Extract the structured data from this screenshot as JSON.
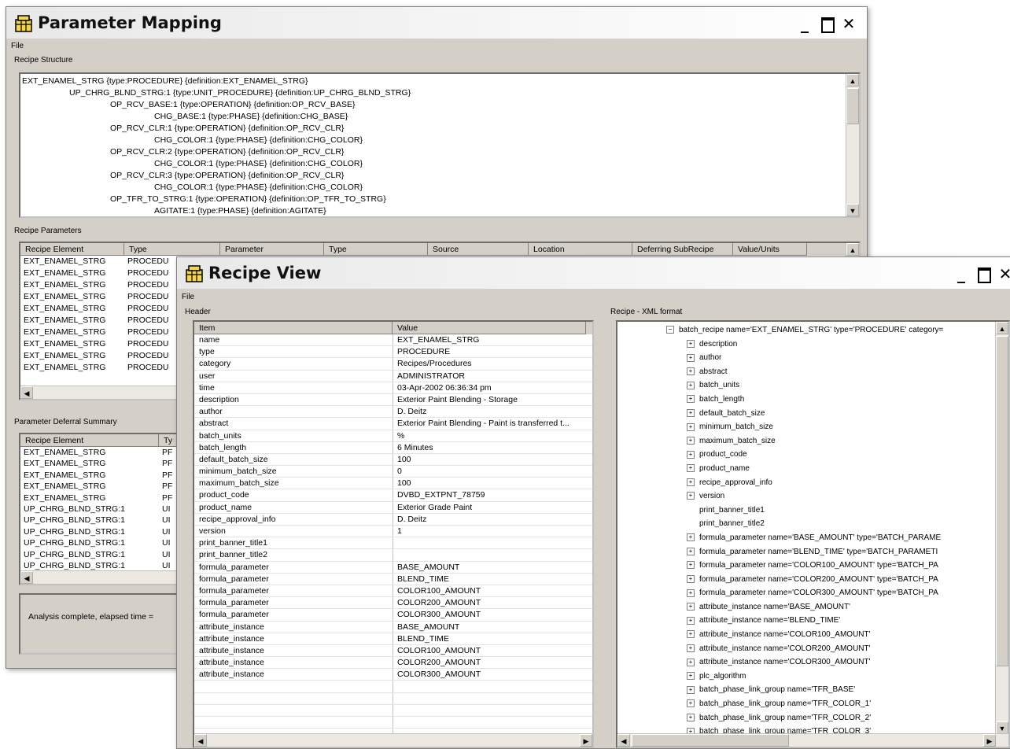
{
  "pm_window": {
    "title": "Parameter Mapping",
    "menu": "File",
    "structure_label": "Recipe Structure",
    "structure_lines": [
      {
        "indent": 0,
        "text": "EXT_ENAMEL_STRG {type:PROCEDURE} {definition:EXT_ENAMEL_STRG}"
      },
      {
        "indent": 1,
        "text": "UP_CHRG_BLND_STRG:1 {type:UNIT_PROCEDURE} {definition:UP_CHRG_BLND_STRG}"
      },
      {
        "indent": 2,
        "text": "OP_RCV_BASE:1 {type:OPERATION} {definition:OP_RCV_BASE}"
      },
      {
        "indent": 3,
        "text": "CHG_BASE:1 {type:PHASE} {definition:CHG_BASE}"
      },
      {
        "indent": 2,
        "text": "OP_RCV_CLR:1 {type:OPERATION} {definition:OP_RCV_CLR}"
      },
      {
        "indent": 3,
        "text": "CHG_COLOR:1 {type:PHASE} {definition:CHG_COLOR}"
      },
      {
        "indent": 2,
        "text": "OP_RCV_CLR:2 {type:OPERATION} {definition:OP_RCV_CLR}"
      },
      {
        "indent": 3,
        "text": "CHG_COLOR:1 {type:PHASE} {definition:CHG_COLOR}"
      },
      {
        "indent": 2,
        "text": "OP_RCV_CLR:3 {type:OPERATION} {definition:OP_RCV_CLR}"
      },
      {
        "indent": 3,
        "text": "CHG_COLOR:1 {type:PHASE} {definition:CHG_COLOR}"
      },
      {
        "indent": 2,
        "text": "OP_TFR_TO_STRG:1 {type:OPERATION} {definition:OP_TFR_TO_STRG}"
      },
      {
        "indent": 3,
        "text": "AGITATE:1 {type:PHASE} {definition:AGITATE}"
      }
    ],
    "params_label": "Recipe Parameters",
    "params_columns": [
      "Recipe Element",
      "Type",
      "Parameter",
      "Type",
      "Source",
      "Location",
      "Deferring SubRecipe",
      "Value/Units"
    ],
    "params_rows": [
      [
        "EXT_ENAMEL_STRG",
        "PROCEDU"
      ],
      [
        "EXT_ENAMEL_STRG",
        "PROCEDU"
      ],
      [
        "EXT_ENAMEL_STRG",
        "PROCEDU"
      ],
      [
        "EXT_ENAMEL_STRG",
        "PROCEDU"
      ],
      [
        "EXT_ENAMEL_STRG",
        "PROCEDU"
      ],
      [
        "EXT_ENAMEL_STRG",
        "PROCEDU"
      ],
      [
        "EXT_ENAMEL_STRG",
        "PROCEDU"
      ],
      [
        "EXT_ENAMEL_STRG",
        "PROCEDU"
      ],
      [
        "EXT_ENAMEL_STRG",
        "PROCEDU"
      ],
      [
        "EXT_ENAMEL_STRG",
        "PROCEDU"
      ]
    ],
    "deferral_label": "Parameter Deferral Summary",
    "deferral_columns": [
      "Recipe Element",
      "Ty"
    ],
    "deferral_rows": [
      [
        "EXT_ENAMEL_STRG",
        "PF"
      ],
      [
        "EXT_ENAMEL_STRG",
        "PF"
      ],
      [
        "EXT_ENAMEL_STRG",
        "PF"
      ],
      [
        "EXT_ENAMEL_STRG",
        "PF"
      ],
      [
        "EXT_ENAMEL_STRG",
        "PF"
      ],
      [
        "UP_CHRG_BLND_STRG:1",
        "UI"
      ],
      [
        "UP_CHRG_BLND_STRG:1",
        "UI"
      ],
      [
        "UP_CHRG_BLND_STRG:1",
        "UI"
      ],
      [
        "UP_CHRG_BLND_STRG:1",
        "UI"
      ],
      [
        "UP_CHRG_BLND_STRG:1",
        "UI"
      ],
      [
        "UP_CHRG_BLND_STRG:1",
        "UI"
      ]
    ],
    "status": "Analysis complete, elapsed time ="
  },
  "rv_window": {
    "title": "Recipe View",
    "menu": "File",
    "header_label": "Header",
    "xml_label": "Recipe - XML format",
    "header_columns": [
      "Item",
      "Value"
    ],
    "header_rows": [
      [
        "name",
        "EXT_ENAMEL_STRG"
      ],
      [
        "type",
        "PROCEDURE"
      ],
      [
        "category",
        "Recipes/Procedures"
      ],
      [
        "user",
        "ADMINISTRATOR"
      ],
      [
        "time",
        "03-Apr-2002 06:36:34 pm"
      ],
      [
        "description",
        "Exterior Paint Blending - Storage"
      ],
      [
        "author",
        "D. Deitz"
      ],
      [
        "abstract",
        "Exterior Paint Blending - Paint is transferred t..."
      ],
      [
        "batch_units",
        "%"
      ],
      [
        "batch_length",
        "6 Minutes"
      ],
      [
        "default_batch_size",
        "100"
      ],
      [
        "minimum_batch_size",
        "0"
      ],
      [
        "maximum_batch_size",
        "100"
      ],
      [
        "product_code",
        "DVBD_EXTPNT_78759"
      ],
      [
        "product_name",
        "Exterior Grade Paint"
      ],
      [
        "recipe_approval_info",
        "D. Deitz"
      ],
      [
        "version",
        "1"
      ],
      [
        "print_banner_title1",
        ""
      ],
      [
        "print_banner_title2",
        ""
      ],
      [
        "formula_parameter",
        "BASE_AMOUNT"
      ],
      [
        "formula_parameter",
        "BLEND_TIME"
      ],
      [
        "formula_parameter",
        "COLOR100_AMOUNT"
      ],
      [
        "formula_parameter",
        "COLOR200_AMOUNT"
      ],
      [
        "formula_parameter",
        "COLOR300_AMOUNT"
      ],
      [
        "attribute_instance",
        "BASE_AMOUNT"
      ],
      [
        "attribute_instance",
        "BLEND_TIME"
      ],
      [
        "attribute_instance",
        "COLOR100_AMOUNT"
      ],
      [
        "attribute_instance",
        "COLOR200_AMOUNT"
      ],
      [
        "attribute_instance",
        "COLOR300_AMOUNT"
      ]
    ],
    "xml_root": "batch_recipe name='EXT_ENAMEL_STRG' type='PROCEDURE' category=",
    "xml_nodes": [
      {
        "expand": true,
        "text": "description"
      },
      {
        "expand": true,
        "text": "author"
      },
      {
        "expand": true,
        "text": "abstract"
      },
      {
        "expand": true,
        "text": "batch_units"
      },
      {
        "expand": true,
        "text": "batch_length"
      },
      {
        "expand": true,
        "text": "default_batch_size"
      },
      {
        "expand": true,
        "text": "minimum_batch_size"
      },
      {
        "expand": true,
        "text": "maximum_batch_size"
      },
      {
        "expand": true,
        "text": "product_code"
      },
      {
        "expand": true,
        "text": "product_name"
      },
      {
        "expand": true,
        "text": "recipe_approval_info"
      },
      {
        "expand": true,
        "text": "version"
      },
      {
        "expand": false,
        "text": "print_banner_title1"
      },
      {
        "expand": false,
        "text": "print_banner_title2"
      },
      {
        "expand": true,
        "text": "formula_parameter name='BASE_AMOUNT' type='BATCH_PARAME"
      },
      {
        "expand": true,
        "text": "formula_parameter name='BLEND_TIME' type='BATCH_PARAMETI"
      },
      {
        "expand": true,
        "text": "formula_parameter name='COLOR100_AMOUNT' type='BATCH_PA"
      },
      {
        "expand": true,
        "text": "formula_parameter name='COLOR200_AMOUNT' type='BATCH_PA"
      },
      {
        "expand": true,
        "text": "formula_parameter name='COLOR300_AMOUNT' type='BATCH_PA"
      },
      {
        "expand": true,
        "text": "attribute_instance name='BASE_AMOUNT'"
      },
      {
        "expand": true,
        "text": "attribute_instance name='BLEND_TIME'"
      },
      {
        "expand": true,
        "text": "attribute_instance name='COLOR100_AMOUNT'"
      },
      {
        "expand": true,
        "text": "attribute_instance name='COLOR200_AMOUNT'"
      },
      {
        "expand": true,
        "text": "attribute_instance name='COLOR300_AMOUNT'"
      },
      {
        "expand": true,
        "text": "plc_algorithm"
      },
      {
        "expand": true,
        "text": "batch_phase_link_group name='TFR_BASE'"
      },
      {
        "expand": true,
        "text": "batch_phase_link_group name='TFR_COLOR_1'"
      },
      {
        "expand": true,
        "text": "batch_phase_link_group name='TFR_COLOR_2'"
      },
      {
        "expand": true,
        "text": "batch_phase_link_group name='TFR_COLOR_3'"
      }
    ]
  }
}
